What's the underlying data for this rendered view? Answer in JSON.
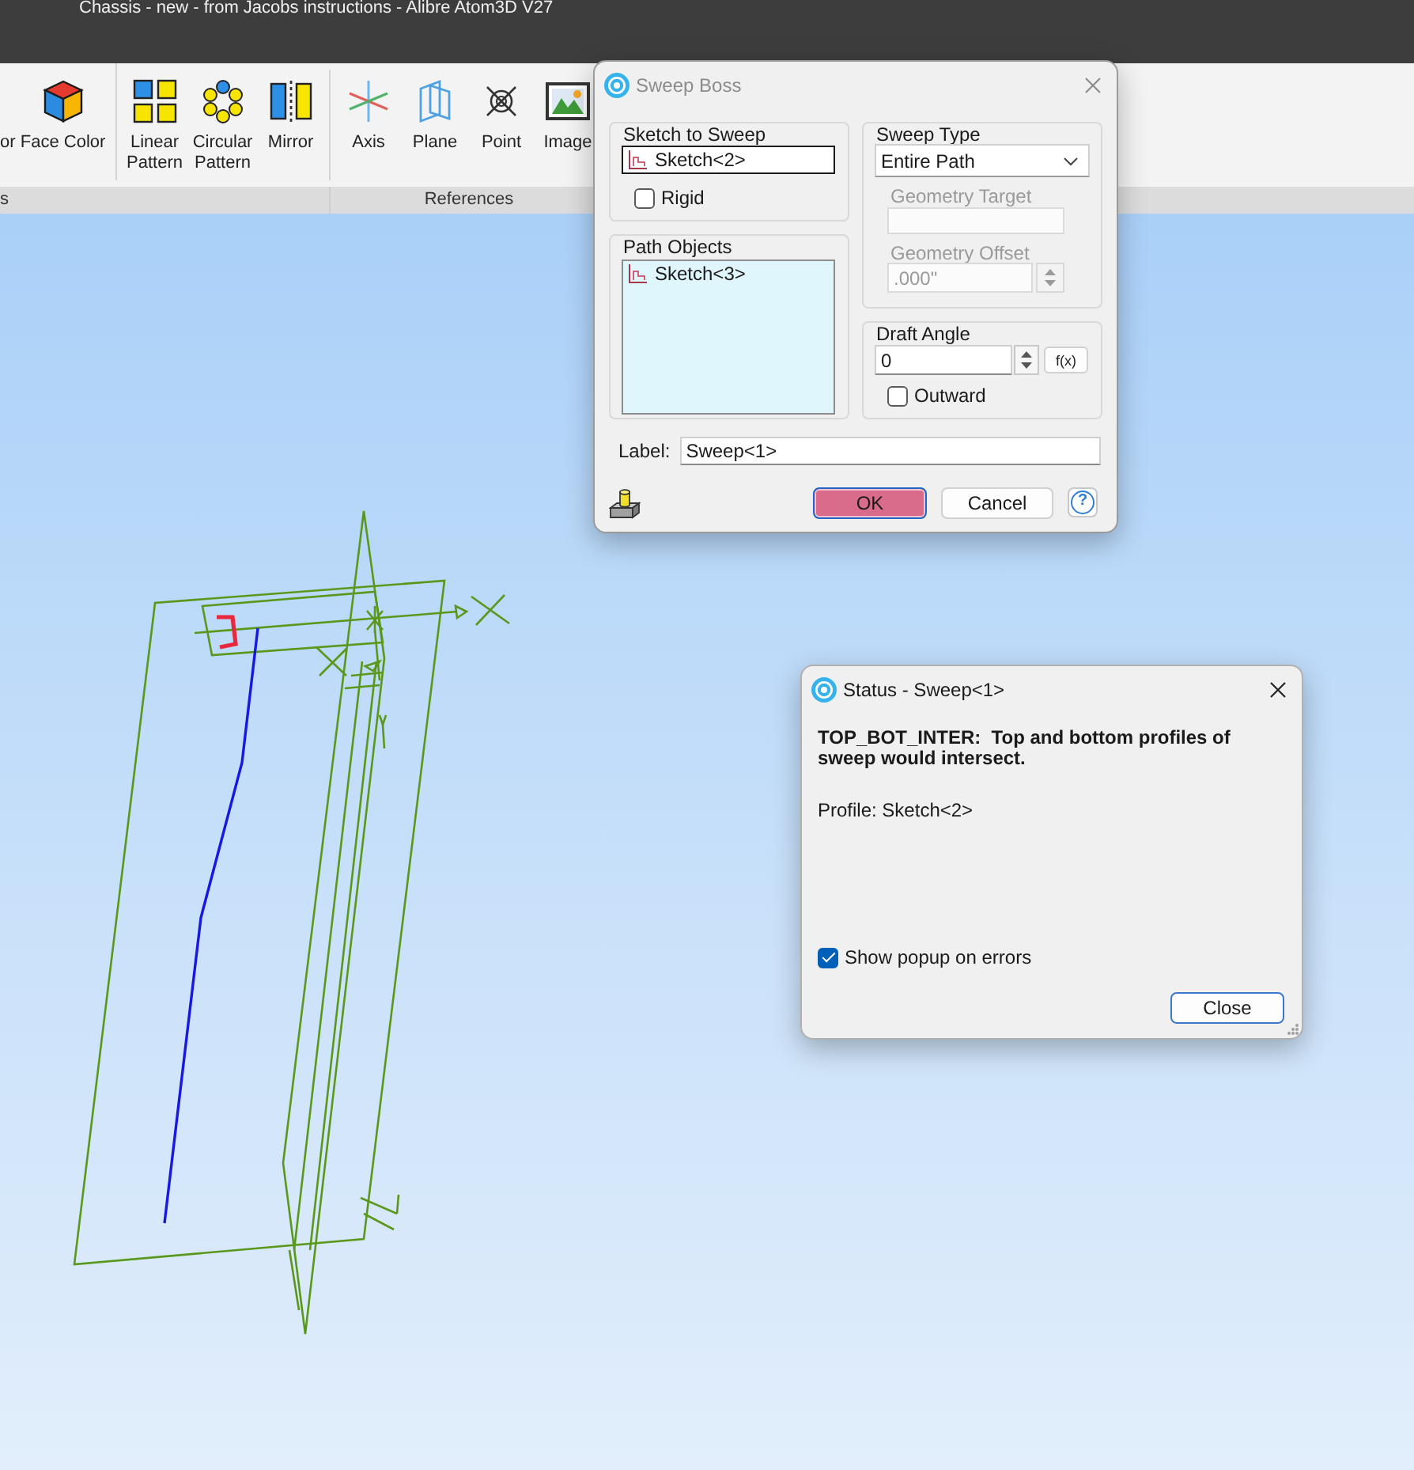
{
  "window": {
    "title": "Chassis - new - from Jacobs instructions - Alibre Atom3D V27"
  },
  "ribbon": {
    "groups": [
      {
        "label": "s",
        "sections": [
          {
            "items": [
              {
                "label": "or",
                "kind": "clipped"
              },
              {
                "label": "Face Color",
                "kind": "face"
              }
            ]
          },
          {
            "items": [
              {
                "label": "Linear Pattern",
                "kind": "linear"
              },
              {
                "label": "Circular Pattern",
                "kind": "circular"
              },
              {
                "label": "Mirror",
                "kind": "mirror"
              }
            ]
          }
        ]
      },
      {
        "label": "References",
        "sections": [
          {
            "items": [
              {
                "label": "Axis",
                "kind": "axis"
              },
              {
                "label": "Plane",
                "kind": "plane"
              },
              {
                "label": "Point",
                "kind": "point"
              },
              {
                "label": "Image",
                "kind": "image"
              }
            ]
          }
        ]
      }
    ]
  },
  "sweep_dialog": {
    "title": "Sweep Boss",
    "active": false,
    "sketch_to_sweep": {
      "label": "Sketch to Sweep",
      "value": "Sketch<2>",
      "focused": true
    },
    "rigid": {
      "label": "Rigid",
      "checked": false
    },
    "path_objects": {
      "label": "Path Objects",
      "items": [
        {
          "label": "Sketch<3>"
        }
      ]
    },
    "sweep_type": {
      "label": "Sweep Type",
      "value": "Entire Path"
    },
    "geometry_target": {
      "label": "Geometry Target",
      "disabled": true
    },
    "geometry_offset": {
      "label": "Geometry Offset",
      "value": ".000\"",
      "disabled": true
    },
    "draft_angle": {
      "label": "Draft Angle",
      "value": "0",
      "formula_button": "f(x)"
    },
    "outward": {
      "label": "Outward",
      "checked": false
    },
    "label_field": {
      "label": "Label:",
      "value": "Sweep<1>"
    },
    "buttons": [
      {
        "label": "OK",
        "kind": "default"
      },
      {
        "label": "Cancel",
        "kind": "normal"
      },
      {
        "label": "?",
        "kind": "help"
      }
    ]
  },
  "status_dialog": {
    "title": "Status - Sweep<1>",
    "active": true,
    "message": "TOP_BOT_INTER:  Top and bottom profiles of sweep would intersect.",
    "detail": "Profile: Sketch<2>",
    "show_popup": {
      "label": "Show popup on errors",
      "checked": true
    },
    "close_button": "Close"
  }
}
